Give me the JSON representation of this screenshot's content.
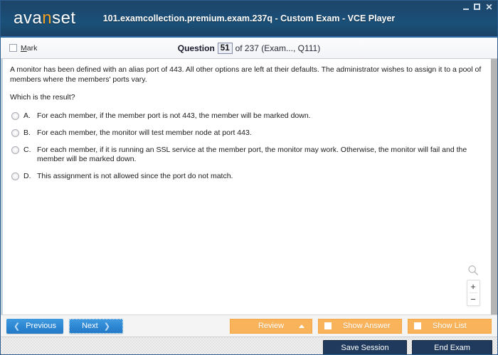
{
  "window": {
    "title": "101.examcollection.premium.exam.237q - Custom Exam - VCE Player",
    "logo_text_a": "ava",
    "logo_text_accent": "n",
    "logo_text_b": "set",
    "controls": {
      "minimize": "—",
      "maximize": "□",
      "close": "✕"
    }
  },
  "question_bar": {
    "mark_accel": "M",
    "mark_rest": "ark",
    "question_label": "Question",
    "question_number": "51",
    "of_text": "of 237 (Exam..., Q111)"
  },
  "question": {
    "paragraph_1": "A monitor has been defined with an alias port of 443. All other options are left at their defaults. The administrator wishes to assign it to a pool of members where the members' ports vary.",
    "paragraph_2": "Which is the result?",
    "options": [
      {
        "letter": "A.",
        "text": "For each member, if the member port is not 443, the member will be marked down."
      },
      {
        "letter": "B.",
        "text": "For each member, the monitor will test member node at port 443."
      },
      {
        "letter": "C.",
        "text": "For each member, if it is running an SSL service at the member port, the monitor may work. Otherwise, the monitor will fail and the member will be marked down."
      },
      {
        "letter": "D.",
        "text": "This assignment is not allowed since the port do not match."
      }
    ]
  },
  "zoom_widget": {
    "magnifier_label": "search-zoom",
    "zoom_in": "+",
    "zoom_out": "−"
  },
  "action_bar": {
    "previous_label": "Previous",
    "previous_chevron": "❮",
    "next_label": "Next",
    "next_chevron": "❯",
    "review_label": "Review",
    "show_answer_label": "Show Answer",
    "show_list_label": "Show List"
  },
  "status_bar": {
    "save_session_label": "Save Session",
    "end_exam_label": "End Exam"
  },
  "colors": {
    "titlebar_dark": "#1b4a72",
    "logo_accent": "#f5a425",
    "nav_blue": "#2f88d3",
    "orange": "#f8b35b",
    "dark_navy": "#1f3a5c",
    "accent_underline": "#2b63ad"
  }
}
